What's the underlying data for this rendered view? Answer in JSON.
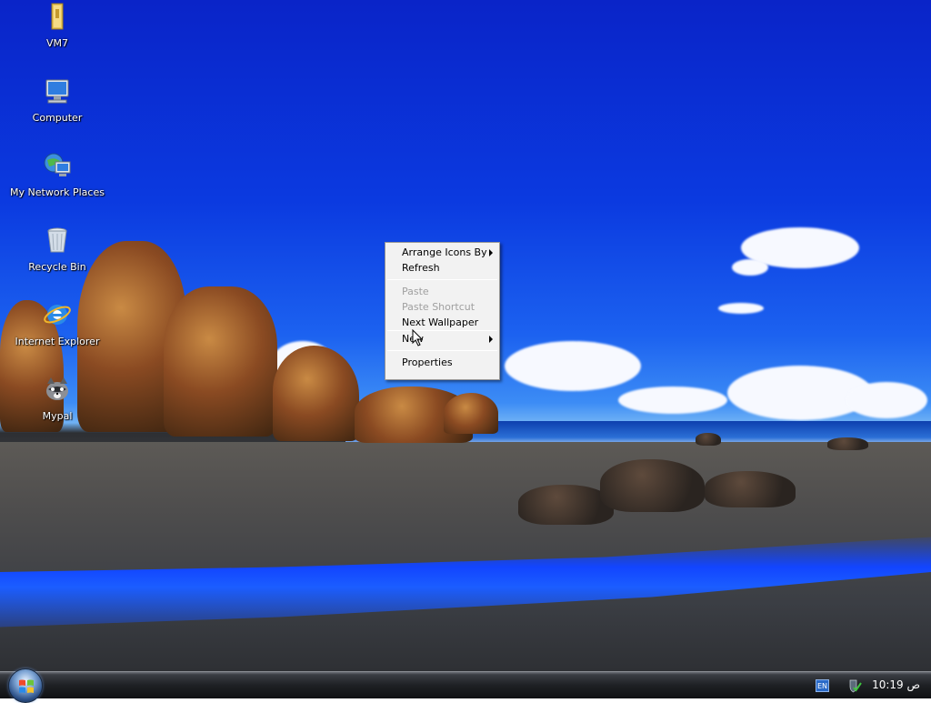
{
  "desktop_icons": [
    {
      "label": "VM7",
      "icon": "folder-icon"
    },
    {
      "label": "Computer",
      "icon": "computer-icon"
    },
    {
      "label": "My Network Places",
      "icon": "network-places-icon"
    },
    {
      "label": "Recycle Bin",
      "icon": "recycle-bin-icon"
    },
    {
      "label": "Internet Explorer",
      "icon": "internet-explorer-icon"
    },
    {
      "label": "Mypal",
      "icon": "mypal-browser-icon"
    }
  ],
  "context_menu": {
    "arrange_icons_by": "Arrange Icons By",
    "refresh": "Refresh",
    "paste": "Paste",
    "paste_shortcut": "Paste Shortcut",
    "next_wallpaper": "Next Wallpaper",
    "new": "New",
    "properties": "Properties"
  },
  "taskbar": {
    "language": "EN",
    "clock": "10:19 ص"
  },
  "colors": {
    "sky": "#0b3ae0",
    "menu_bg": "#f2f2f2",
    "disabled_text": "#a0a0a0"
  }
}
